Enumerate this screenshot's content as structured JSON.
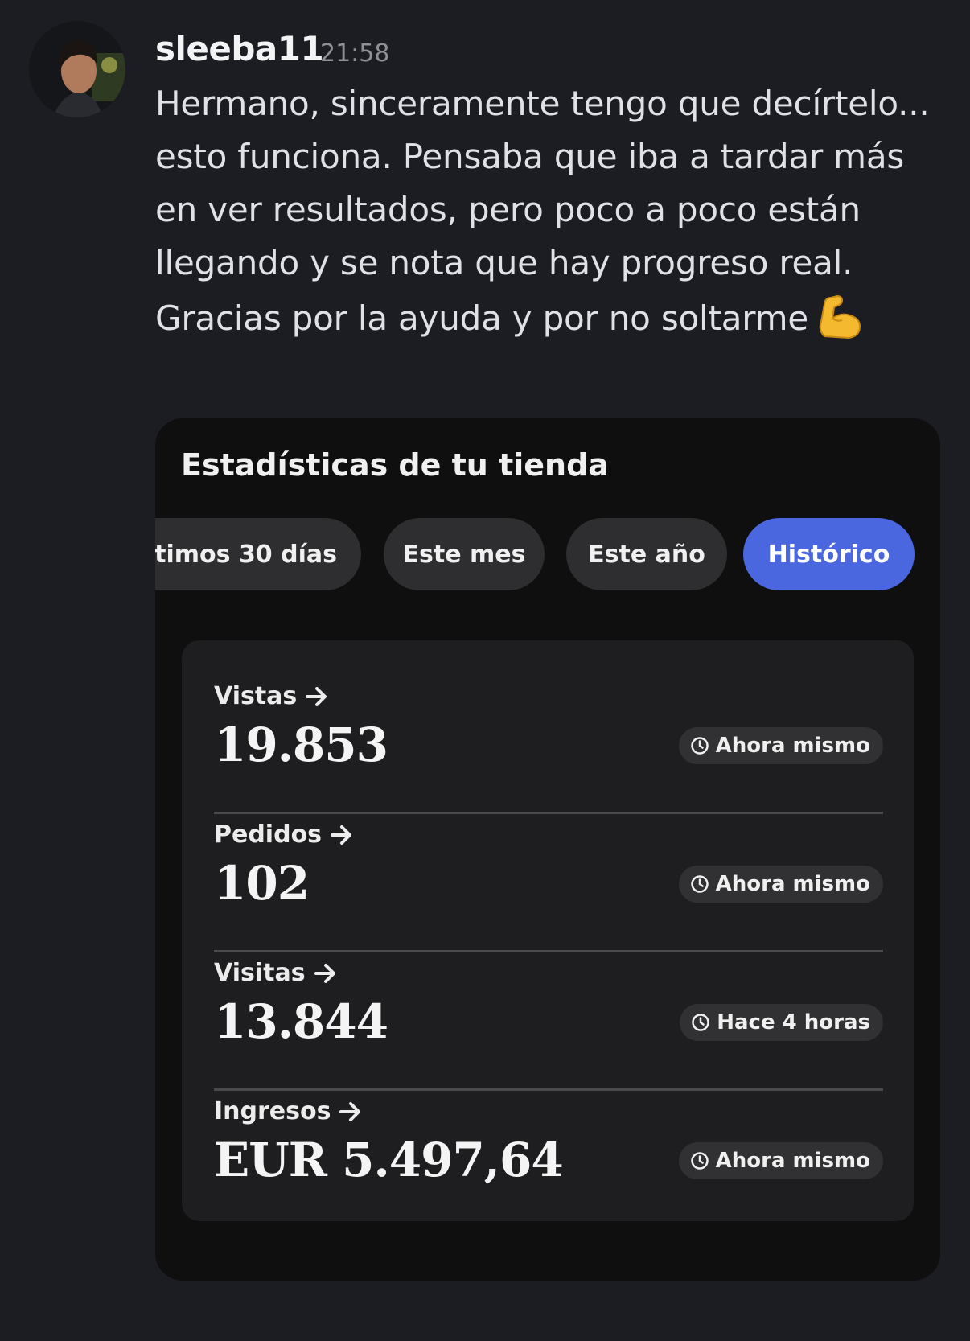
{
  "message": {
    "username": "sleeba11",
    "time": "21:58",
    "text": "Hermano, sinceramente tengo que decírtelo... esto funciona. Pensaba que iba a tardar más en ver resultados, pero poco a poco están llegando y se nota que hay progreso real. Gracias por la ayuda y por no soltarme",
    "emoji": "flexed-biceps"
  },
  "attachment": {
    "title": "Estadísticas de tu tienda",
    "tabs": [
      {
        "label": "ltimos 30 días",
        "active": false
      },
      {
        "label": "Este mes",
        "active": false
      },
      {
        "label": "Este año",
        "active": false
      },
      {
        "label": "Histórico",
        "active": true
      }
    ],
    "active_tab_color": "#4b67e0",
    "stats": [
      {
        "label": "Vistas",
        "value": "19.853",
        "updated": "Ahora mismo"
      },
      {
        "label": "Pedidos",
        "value": "102",
        "updated": "Ahora mismo"
      },
      {
        "label": "Visitas",
        "value": "13.844",
        "updated": "Hace 4 horas"
      },
      {
        "label": "Ingresos",
        "value": "EUR 5.497,64",
        "updated": "Ahora mismo"
      }
    ]
  }
}
